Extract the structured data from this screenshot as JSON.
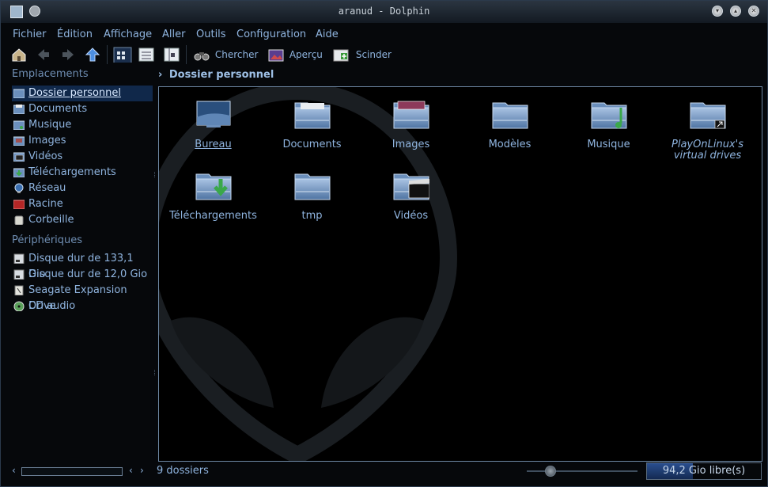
{
  "window": {
    "title": "aranud - Dolphin"
  },
  "menu": [
    "Fichier",
    "Édition",
    "Affichage",
    "Aller",
    "Outils",
    "Configuration",
    "Aide"
  ],
  "toolbar": {
    "search": "Chercher",
    "preview": "Aperçu",
    "split": "Scinder"
  },
  "sidebar": {
    "places_title": "Emplacements",
    "places": [
      "Dossier personnel",
      "Documents",
      "Musique",
      "Images",
      "Vidéos",
      "Téléchargements",
      "Réseau",
      "Racine",
      "Corbeille"
    ],
    "devices_title": "Périphériques",
    "devices": [
      "Disque dur de 133,1 Gio",
      "Disque dur de 12,0 Gio",
      "Seagate Expansion Drive",
      "CD audio"
    ]
  },
  "breadcrumb": "Dossier personnel",
  "items": [
    {
      "name": "Bureau",
      "icon": "desktop-folder"
    },
    {
      "name": "Documents",
      "icon": "documents-folder"
    },
    {
      "name": "Images",
      "icon": "images-folder"
    },
    {
      "name": "Modèles",
      "icon": "folder"
    },
    {
      "name": "Musique",
      "icon": "music-folder"
    },
    {
      "name": "PlayOnLinux's virtual drives",
      "icon": "link-folder"
    },
    {
      "name": "Téléchargements",
      "icon": "downloads-folder"
    },
    {
      "name": "tmp",
      "icon": "folder"
    },
    {
      "name": "Vidéos",
      "icon": "videos-folder"
    }
  ],
  "status": {
    "text": "9 dossiers",
    "free_space": "94,2 Gio libre(s)",
    "zoom_level": 0.18,
    "used_fraction": 0.4
  },
  "colors": {
    "accent": "#8fb4df",
    "selection": "#10284a",
    "background": "#000000"
  }
}
